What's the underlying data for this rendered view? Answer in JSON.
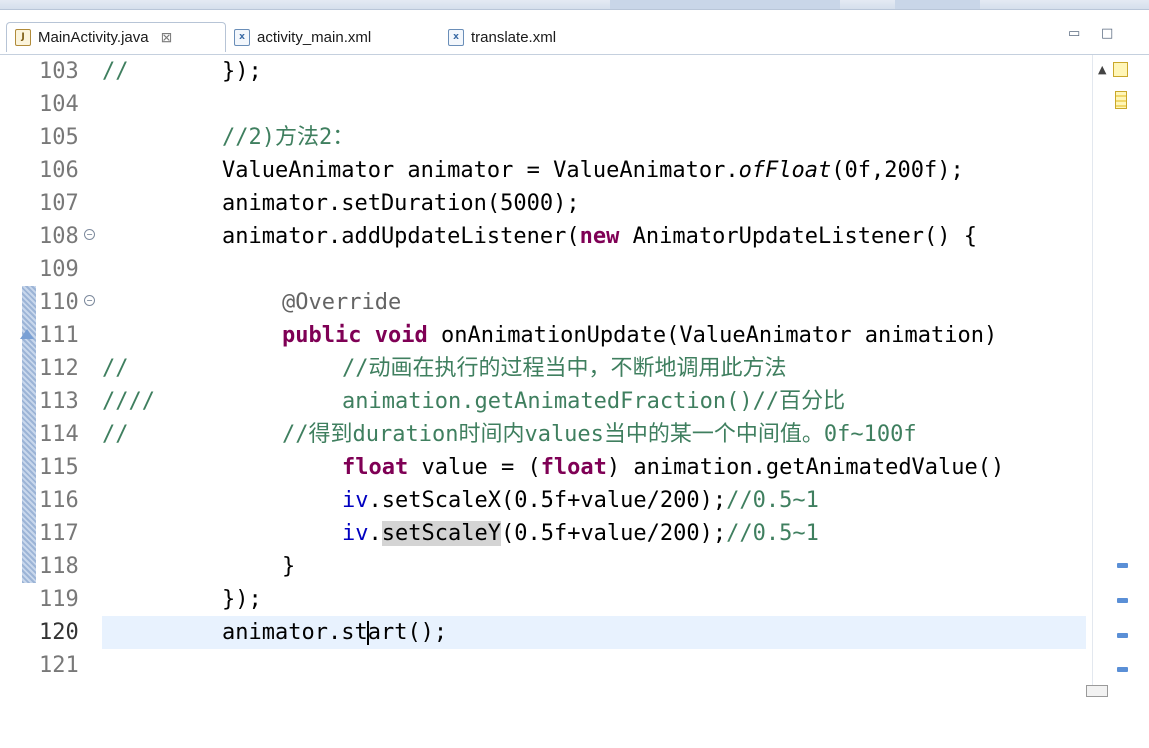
{
  "tabs": [
    {
      "label": "MainActivity.java",
      "icon": "java-file-icon",
      "active": true,
      "close": "⊠"
    },
    {
      "label": "activity_main.xml",
      "icon": "xml-file-icon",
      "active": false
    },
    {
      "label": "translate.xml",
      "icon": "xml-file-icon",
      "active": false
    }
  ],
  "window_controls": {
    "minimize": "▭",
    "maximize": "□"
  },
  "editor": {
    "current_line": "120",
    "lines": [
      {
        "num": "103",
        "prefix": "//",
        "code": "});"
      },
      {
        "num": "104",
        "prefix": "",
        "code": ""
      },
      {
        "num": "105",
        "prefix": "",
        "code": "//2)方法2："
      },
      {
        "num": "106",
        "prefix": "",
        "code": "ValueAnimator animator = ValueAnimator.ofFloat(0f,200f);"
      },
      {
        "num": "107",
        "prefix": "",
        "code": "animator.setDuration(5000);"
      },
      {
        "num": "108",
        "prefix": "",
        "code": "animator.addUpdateListener(new AnimatorUpdateListener() {"
      },
      {
        "num": "109",
        "prefix": "",
        "code": ""
      },
      {
        "num": "110",
        "prefix": "",
        "code": "@Override"
      },
      {
        "num": "111",
        "prefix": "",
        "code": "public void onAnimationUpdate(ValueAnimator animation)"
      },
      {
        "num": "112",
        "prefix": "//",
        "code": "//动画在执行的过程当中，不断地调用此方法"
      },
      {
        "num": "113",
        "prefix": "////",
        "code": "animation.getAnimatedFraction()//百分比"
      },
      {
        "num": "114",
        "prefix": "//",
        "code": "//得到duration时间内values当中的某一个中间值。0f~100f"
      },
      {
        "num": "115",
        "prefix": "",
        "code": "float value = (float) animation.getAnimatedValue()"
      },
      {
        "num": "116",
        "prefix": "",
        "code": "iv.setScaleX(0.5f+value/200);//0.5~1"
      },
      {
        "num": "117",
        "prefix": "",
        "code": "iv.setScaleY(0.5f+value/200);//0.5~1"
      },
      {
        "num": "118",
        "prefix": "",
        "code": "}"
      },
      {
        "num": "119",
        "prefix": "",
        "code": "});"
      },
      {
        "num": "120",
        "prefix": "",
        "code": "animator.start();"
      },
      {
        "num": "121",
        "prefix": "",
        "code": ""
      }
    ]
  },
  "colors": {
    "comment": "#3f7f5f",
    "keyword": "#7f0055",
    "field": "#0000c0",
    "annotation": "#646464",
    "current_line_bg": "#e8f2fe"
  }
}
